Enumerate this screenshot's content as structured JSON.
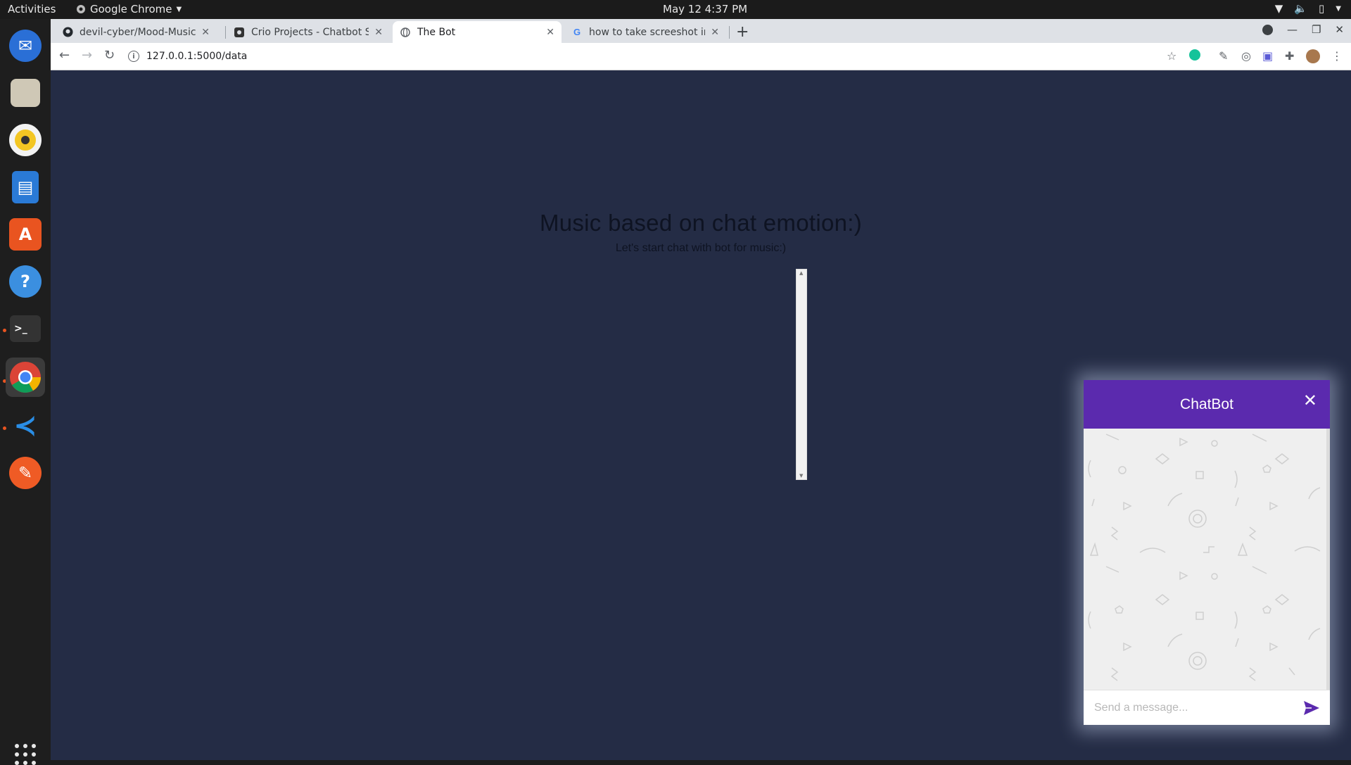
{
  "system": {
    "activities": "Activities",
    "app_name": "Google Chrome",
    "clock": "May 12  4:37 PM"
  },
  "browser": {
    "tabs": [
      {
        "title": "devil-cyber/Mood-Music",
        "icon": "github-icon"
      },
      {
        "title": "Crio Projects - Chatbot So",
        "icon": "crio-icon"
      },
      {
        "title": "The Bot",
        "icon": "globe-icon",
        "active": true
      },
      {
        "title": "how to take screeshot in u",
        "icon": "google-icon"
      }
    ],
    "url": "127.0.0.1:5000/data"
  },
  "page": {
    "title": "Music based on chat emotion:)",
    "subtitle": "Let's start chat with bot for music:)"
  },
  "chatbot": {
    "title": "ChatBot",
    "input_placeholder": "Send a message..."
  },
  "colors": {
    "page_background": "#242c45",
    "chat_header": "#5b2aae",
    "send_icon": "#5b2aae"
  }
}
